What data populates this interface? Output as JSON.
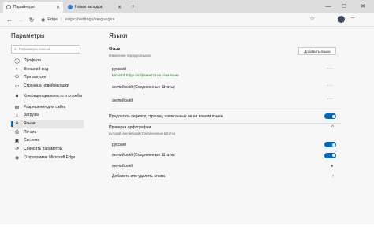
{
  "tabs": [
    {
      "label": "Параметры",
      "icon": "gear-icon"
    },
    {
      "label": "Новая вкладка",
      "icon": "edge-icon"
    }
  ],
  "toolbar": {
    "host": "Edge",
    "url": "edge://settings/languages"
  },
  "sidebar": {
    "title": "Параметры",
    "search_placeholder": "Параметры поиска",
    "items": [
      {
        "label": "Профили",
        "icon": "profile-icon"
      },
      {
        "label": "Внешний вид",
        "icon": "appearance-icon"
      },
      {
        "label": "При запуске",
        "icon": "power-icon"
      },
      {
        "label": "Страница новой вкладки",
        "icon": "new-tab-icon"
      },
      {
        "label": "Конфиденциальность и службы",
        "icon": "lock-icon"
      },
      {
        "label": "Разрешения для сайта",
        "icon": "site-permissions-icon"
      },
      {
        "label": "Загрузки",
        "icon": "download-icon"
      },
      {
        "label": "Языки",
        "icon": "languages-icon"
      },
      {
        "label": "Печать",
        "icon": "printer-icon"
      },
      {
        "label": "Система",
        "icon": "system-icon"
      },
      {
        "label": "Сбросить параметры",
        "icon": "reset-icon"
      },
      {
        "label": "О программе Microsoft Edge",
        "icon": "edge-icon"
      }
    ],
    "active_index": 7
  },
  "main": {
    "title": "Языки",
    "languages_section": {
      "title": "Язык",
      "subtitle": "Изменение порядка языков",
      "add_button": "Добавить языки"
    },
    "languages": [
      {
        "name": "русский",
        "note": "Microsoft Edge отображается на этом языке"
      },
      {
        "name": "английский (Соединенные Штаты)",
        "note": ""
      },
      {
        "name": "английский",
        "note": ""
      }
    ],
    "translate_offer": {
      "label": "Предлагать перевод страниц, написанных не на вашем языке",
      "on": true
    },
    "spellcheck": {
      "title": "Проверка орфографии",
      "subtitle": "русский, английский (Соединенные Штаты)",
      "on": true,
      "items": [
        {
          "label": "русский",
          "state": "on"
        },
        {
          "label": "английский (Соединенные Штаты)",
          "state": "on"
        },
        {
          "label": "английский",
          "state": "dot"
        }
      ],
      "add_words": "Добавить или удалить слова"
    }
  },
  "colors": {
    "accent": "#0067c0",
    "note_green": "#107c10"
  }
}
